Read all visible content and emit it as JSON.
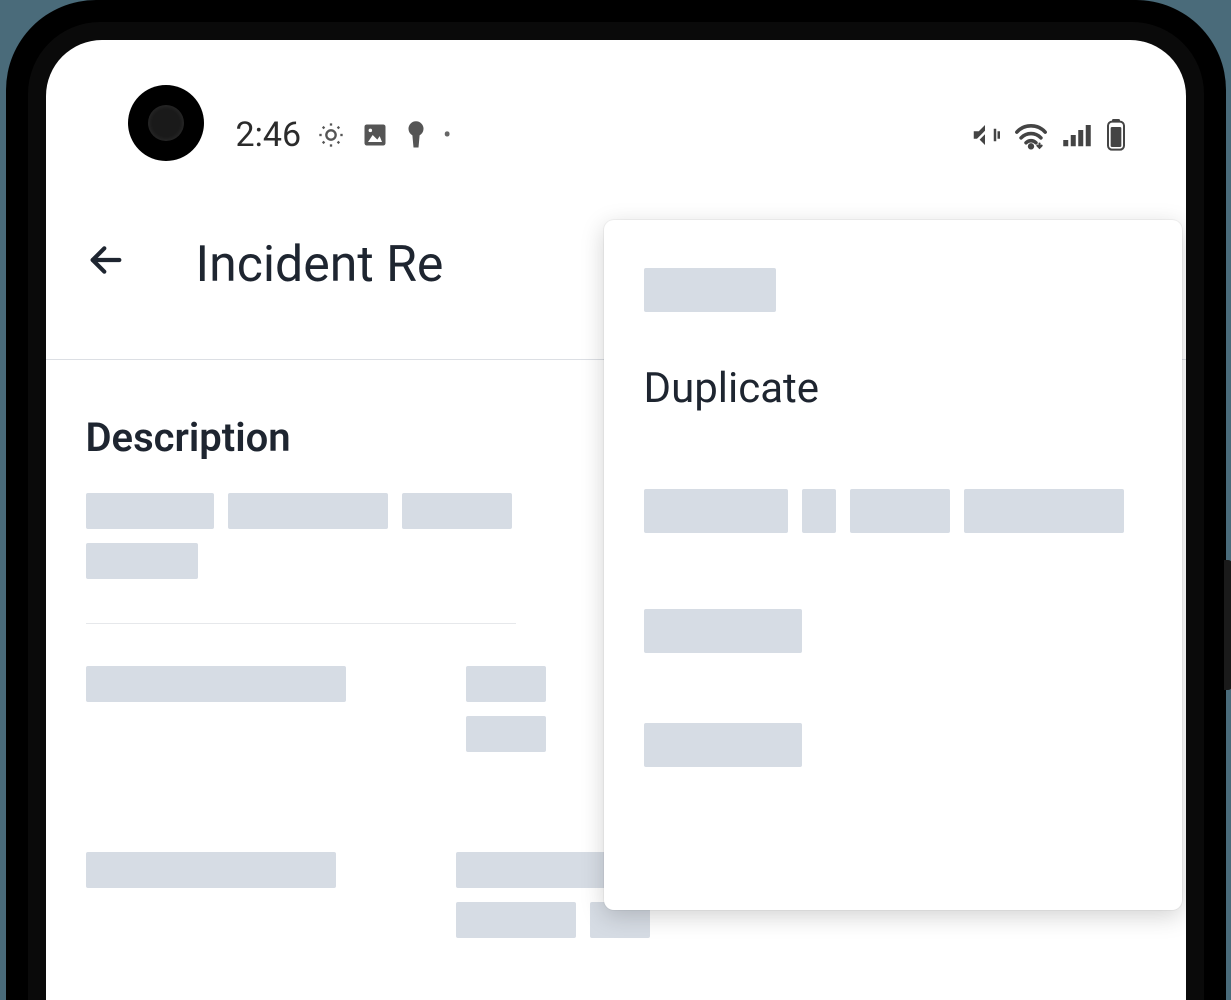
{
  "status_bar": {
    "time": "2:46"
  },
  "header": {
    "title": "Incident Re"
  },
  "content": {
    "description_label": "Description"
  },
  "popup": {
    "menu_item_duplicate": "Duplicate"
  }
}
